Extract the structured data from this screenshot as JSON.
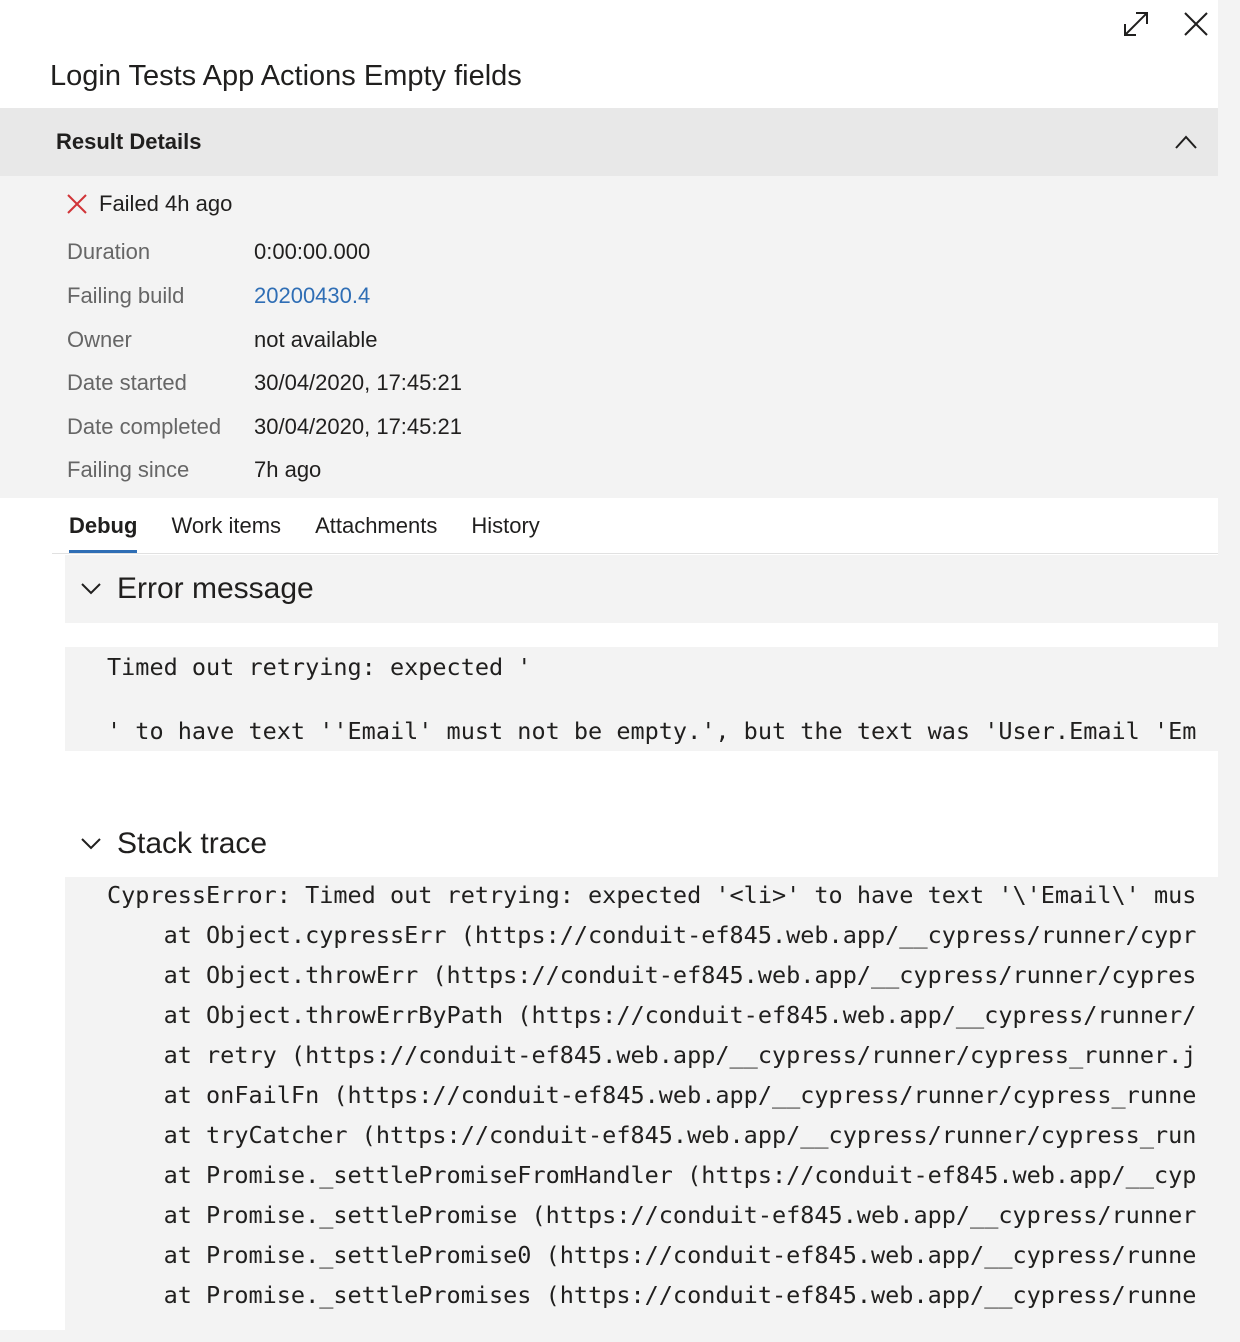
{
  "panel": {
    "title": "Login Tests App Actions Empty fields",
    "icons": {
      "expand": "expand-icon",
      "close": "close-icon"
    }
  },
  "result_details": {
    "header": "Result Details",
    "status": "Failed 4h ago",
    "status_color": "#d13438",
    "rows": [
      {
        "label": "Duration",
        "value": "0:00:00.000"
      },
      {
        "label": "Failing build",
        "value": "20200430.4"
      },
      {
        "label": "Owner",
        "value": "not available"
      },
      {
        "label": "Date started",
        "value": "30/04/2020, 17:45:21"
      },
      {
        "label": "Date completed",
        "value": "30/04/2020, 17:45:21"
      },
      {
        "label": "Failing since",
        "value": "7h ago"
      }
    ]
  },
  "tabs": [
    "Debug",
    "Work items",
    "Attachments",
    "History"
  ],
  "active_tab": "Debug",
  "accent_color": "#2f6eb5",
  "error_message": {
    "title": "Error message",
    "lines": [
      "Timed out retrying: expected '",
      "",
      "' to have text ''Email' must not be empty.', but the text was 'User.Email 'Em"
    ]
  },
  "stack_trace": {
    "title": "Stack trace",
    "lines": [
      "CypressError: Timed out retrying: expected '<li>' to have text '\\'Email\\' mus",
      "    at Object.cypressErr (https://conduit-ef845.web.app/__cypress/runner/cypr",
      "    at Object.throwErr (https://conduit-ef845.web.app/__cypress/runner/cypres",
      "    at Object.throwErrByPath (https://conduit-ef845.web.app/__cypress/runner/",
      "    at retry (https://conduit-ef845.web.app/__cypress/runner/cypress_runner.j",
      "    at onFailFn (https://conduit-ef845.web.app/__cypress/runner/cypress_runne",
      "    at tryCatcher (https://conduit-ef845.web.app/__cypress/runner/cypress_run",
      "    at Promise._settlePromiseFromHandler (https://conduit-ef845.web.app/__cyp",
      "    at Promise._settlePromise (https://conduit-ef845.web.app/__cypress/runner",
      "    at Promise._settlePromise0 (https://conduit-ef845.web.app/__cypress/runne",
      "    at Promise._settlePromises (https://conduit-ef845.web.app/__cypress/runne"
    ]
  }
}
